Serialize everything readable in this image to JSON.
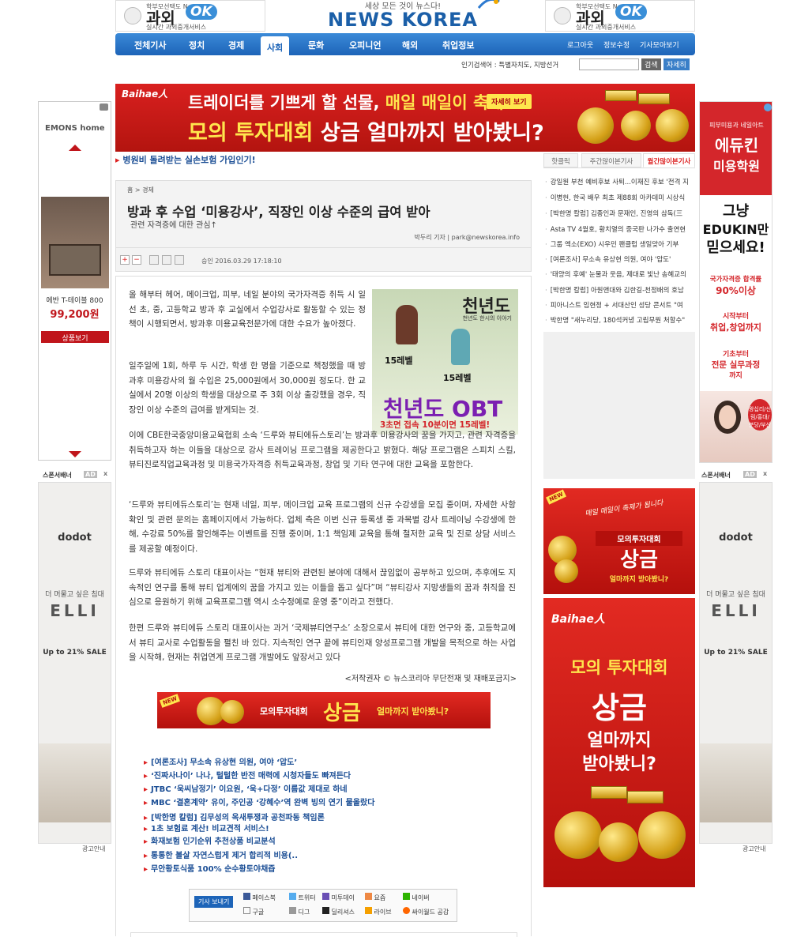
{
  "top_ads": {
    "left": {
      "top_line": "학부모선택도 No.1",
      "brand": "과외",
      "ok": "OK",
      "bottom_line": "실시간 과외중개서비스"
    },
    "right": {
      "top_line": "학부모선택도 No.1",
      "brand": "과외",
      "ok": "OK",
      "bottom_line": "실시간 과외중개서비스"
    }
  },
  "logo": {
    "slogan": "세상 모든 것이 뉴스다!",
    "name": "NEWS KOREA"
  },
  "nav": {
    "items": [
      "전체기사",
      "정치",
      "경제",
      "사회",
      "문화",
      "오피니언",
      "해외",
      "취업정보"
    ],
    "active": "사회",
    "right": [
      "로그아웃",
      "정보수정",
      "기사모아보기"
    ]
  },
  "search": {
    "label": "인기검색어 : 특별자치도, 지방선거",
    "button": "검색",
    "detail_button": "자세히"
  },
  "main_banner": {
    "brand": "Baihae人",
    "line1_a": "트레이더를 기쁘게 할 선물,",
    "line1_b": "매일 매일이 축제!",
    "detail": "자세히 보기",
    "line2_a": "모의 투자대회",
    "line2_b": "상금",
    "line2_c": "얼마까지 받아봤니?"
  },
  "hot_link": "병원비 돌려받는 실손보험 가입인기!",
  "left_ad": {
    "brand": "EMONS home",
    "product": "에반 T-테이블 800",
    "price": "99,200원",
    "button": "상품보기"
  },
  "sponsor_label": "스폰서배너",
  "ad_badge": "AD",
  "close_mark": "x",
  "ad_info": "광고안내",
  "elli_ad": {
    "brand": "dodot",
    "sub": "더 머물고 싶은 침대",
    "big": "ELLI",
    "sale": "Up to 21% SALE"
  },
  "right_top_ad": {
    "small": "피부미용과 네일아트",
    "brand1": "에듀킨",
    "brand2": "미용학원",
    "q1": "그냥",
    "q2": "EDUKIN만",
    "q3": "믿으세요!",
    "p1": "국가자격증 합격률",
    "p2": "90%이상",
    "p3": "시작부터",
    "p4": "취업,창업까지",
    "p5": "기초부터",
    "p6": "전문 실무과정",
    "p7": "까지",
    "loc": "왕십리/신림/홍대/분당/부산"
  },
  "article": {
    "breadcrumb": "홈 > 경제",
    "title": "방과 후 수업 ‘미용강사’, 직장인 이상 수준의 급여 받아",
    "subtitle": "관련 자격증에 대한 관심↑",
    "author": "박두리 기자 | park@newskorea.info",
    "date": "승인 2016.03.29  17:18:10",
    "paragraphs": [
      "올 해부터 헤어, 메이크업, 피부, 네일 분야의 국가자격증 취득 시 일선 초, 중, 고등학교 방과 후 교실에서 수업강사로 활동할 수 있는 정책이 시행되면서, 방과후 미용교육전문가에 대한 수요가 높아졌다.",
      "일주일에 1회, 하루 두 시간, 학생 한 명을 기준으로 책정했을 때 방과후 미용강사의 월 수입은 25,000원에서 30,000원 정도다. 한 교실에서 20명 이상의 학생을 대상으로 주 3회 이상 출강했을 경우, 직장인 이상 수준의 급여를 받게되는 것.",
      "이에 CBE한국중앙미용교육협회 소속 ‘드루와 뷰티에듀스토리’는 방과후 미용강사의 꿈을 가지고, 관련 자격증을 취득하고자 하는 이들을 대상으로 강사 트레이닝 프로그램을 제공한다고 밝혔다. 해당 프로그램은 스피치 스킬, 뷰티진로직업교육과정 및 미용국가자격증 취득교육과정, 창업 및 기타 연구에 대한 교육을 포함한다.",
      "‘드루와 뷰티에듀스토리’는 현재 네일, 피부, 메이크업 교육 프로그램의 신규 수강생을 모집 중이며, 자세한 사항 확인 및 관련 문의는 홈페이지에서 가능하다. 업체 측은 이번 신규 등록생 중 과목별 강사 트레이닝 수강생에 한해, 수강료 50%를 할인해주는 이벤트를 진행 중이며, 1:1 책임제 교육을 통해 철저한 교육 및 진로 상담 서비스를 제공할 예정이다.",
      "드루와 뷰티에듀 스토리 대표이사는 “현재 뷰티와 관련된 분야에 대해서 끊임없이 공부하고 있으며, 추후에도 지속적인 연구를 통해 뷰티 업계에의 꿈을 가지고 있는 이들을 돕고 싶다”며 “뷰티강사 지망생들의 꿈과 취직을 진심으로 응원하기 위해 교육프로그램 역시 소수정예로 운영 중”이라고 전했다.",
      "한편 드루와 뷰티에듀 스토리 대표이사는 과거 ‘국제뷰티연구소’ 소장으로서 뷰티에 대한 연구와 중, 고등학교에서 뷰티 교사로 수업활동을 펼친 바 있다. 지속적인 연구 끝에 뷰티인재 양성프로그램 개발을 목적으로 하는 사업을 시작해, 현재는 취업연계 프로그램 개발에도 앞장서고 있다"
    ],
    "copyright": "<저작권자 © 뉴스코리아 무단전재 및 재배포금지>",
    "game_ad": {
      "title": "천년도",
      "sub": "천년도 한시의 이야기",
      "lv1": "15레벨",
      "lv2": "15레벨",
      "obt": "천년도 OBT",
      "tag": "3초면 접속 10분이면 15레벨!"
    },
    "inline_ad": {
      "new": "NEW",
      "a": "모의투자대회",
      "b": "상금",
      "c": "얼마까지 받아봤니?"
    },
    "related": [
      "[여론조사] 무소속 유상현 의원, 여야 ‘압도’",
      "‘진짜사나이’ 나나, 털털한 반전 매력에 시청자들도 빠져든다",
      "JTBC ‘욱씨남정기’ 이요원, ‘욱+다정’ 이름값 제대로 하네",
      "MBC ‘결혼계약’ 유이, 주인공 ‘강혜수’역 완벽 빙의 연기 물올랐다",
      "[박한명 칼럼] 김무성의 옥새투쟁과 공천파동 책임론",
      "1초 보험료 계산! 비교견적 서비스!",
      "화재보험 인기순위 추천상품 비교분석",
      "통통한 볼살 자연스럽게 제거 합리적 비용(..",
      "무안황토식품 100% 순수황토야채즙"
    ],
    "share": {
      "label": "기사 보내기",
      "items": [
        "페이스북",
        "트위터",
        "미투데이",
        "요즘",
        "네이버",
        "구글",
        "디그",
        "딜리셔스",
        "라이브",
        "싸이월드 공감"
      ]
    }
  },
  "right_col": {
    "tabs": [
      "핫클릭",
      "주간많이본기사",
      "월간많이본기사"
    ],
    "active_tab": "월간많이본기사",
    "news": [
      "강일원 부천 예비후보 사퇴...이재진 후보 '전격 지",
      "이병헌, 한국 배우 최초 제88회 아카데미 시상식",
      "[박한명 칼럼] 김종인과 문재인, 진영의 삼독(三",
      "Asta TV 4월호, 황치열의 중국판 나가수 출연현",
      "그룹 엑소(EXO) 시우민 팬클럽 생일맞아 기부",
      "[여론조사] 무소속 유상현 의원, 여야 '압도'",
      "'태양의 후예' 눈물과 웃음, 제대로 빛난 송혜교의",
      "[박한명 칼럼] 아원앤대와 김한길-천정배의 호남",
      "피아니스트 임현정 + 서대산인 성당 콘서트 \"여",
      "박한명 \"새누리당, 180석커녕 고립무원 처할수\""
    ],
    "ad1": {
      "new": "NEW",
      "cursive": "매일 매일이 축제가 됩니다",
      "a": "모의투자대회",
      "b": "상금",
      "c": "얼마까지 받아봤니?"
    },
    "ad2": {
      "brand": "Baihae人",
      "a": "모의 투자대회",
      "b": "상금",
      "c": "얼마까지",
      "d": "받아봤니?"
    }
  },
  "colors": {
    "nav": "#1d64b8",
    "accent_red": "#d22",
    "link_blue": "#1b4e95",
    "gold": "#d4a017"
  }
}
